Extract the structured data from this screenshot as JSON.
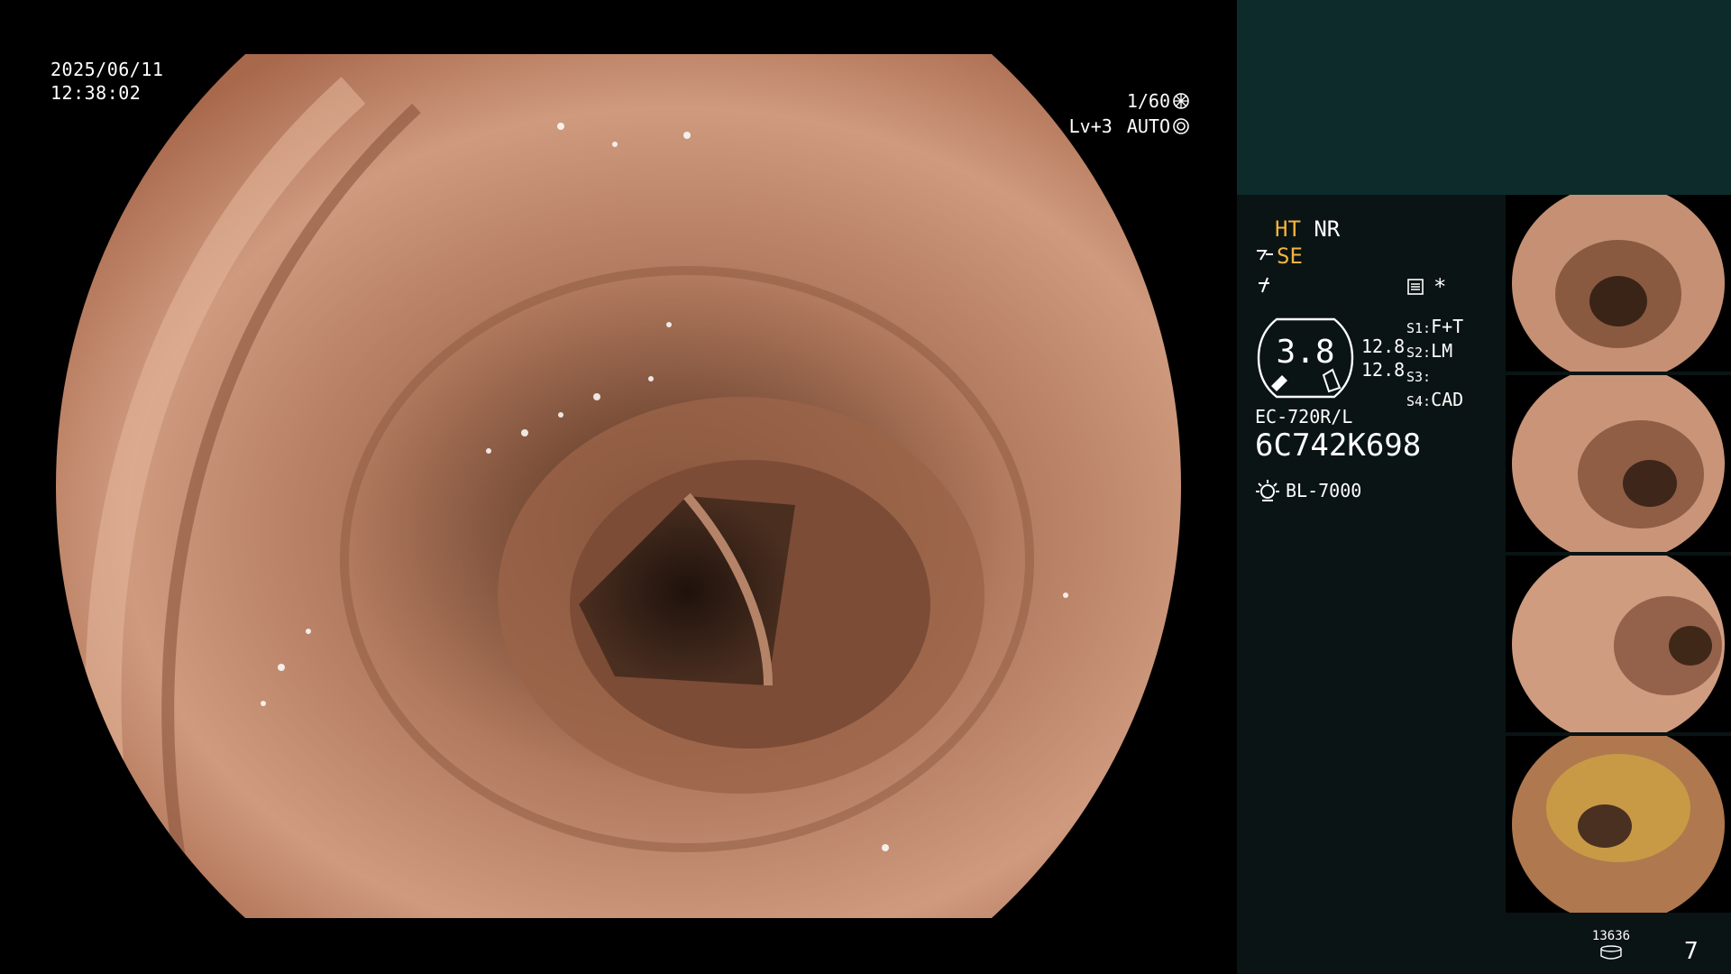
{
  "overlay": {
    "date": "2025/06/11",
    "time": "12:38:02",
    "shutter": "1/60",
    "level": "Lv+3",
    "mode": "AUTO"
  },
  "panel": {
    "ht": "HT",
    "nr": "NR",
    "se": "SE",
    "gauge_value": "3.8",
    "gauge_a": "12.8",
    "gauge_b": "12.8",
    "s1_key": "S1:",
    "s1_val": "F+T",
    "s2_key": "S2:",
    "s2_val": "LM",
    "s3_key": "S3:",
    "s3_val": "",
    "s4_key": "S4:",
    "s4_val": "CAD",
    "scope_model": "EC-720R/L",
    "scope_serial": "6C742K698",
    "light_source": "BL-7000",
    "star": "*"
  },
  "footer": {
    "capture_count": "13636",
    "page": "7"
  },
  "thumbnails": [
    {
      "label": "thumbnail-1"
    },
    {
      "label": "thumbnail-2"
    },
    {
      "label": "thumbnail-3"
    },
    {
      "label": "thumbnail-4"
    }
  ],
  "colors": {
    "side_top": "#0d2b2b",
    "side": "#0a1414",
    "accent": "#f3b340",
    "mucosa": "#c48a6c"
  }
}
